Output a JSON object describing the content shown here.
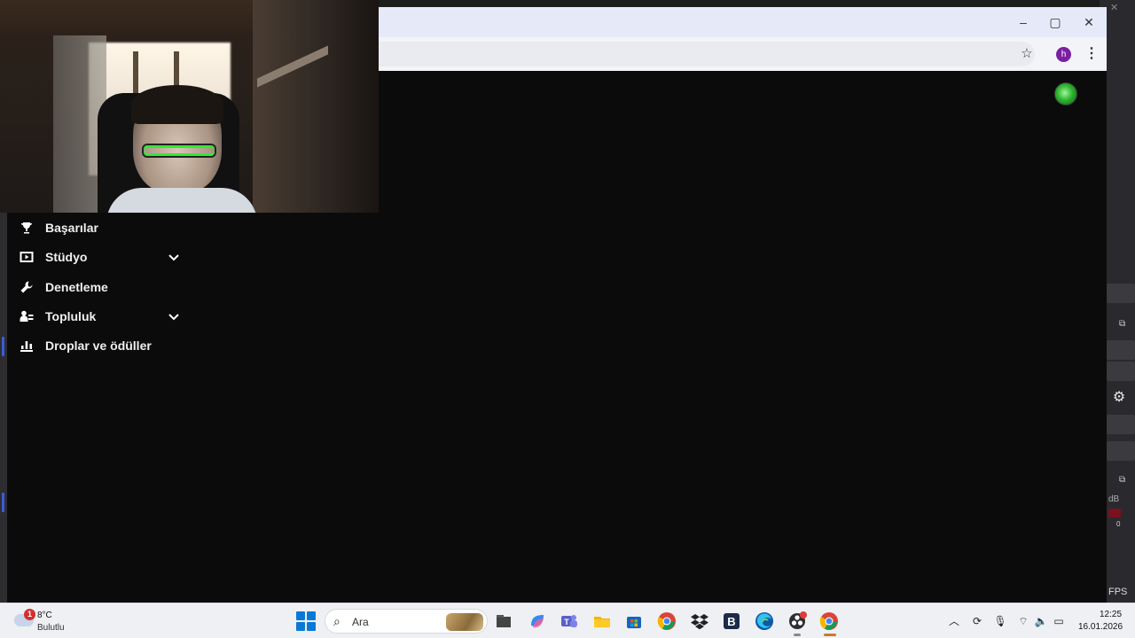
{
  "dashboard_menu": {
    "items": [
      {
        "label": "Başarılar",
        "icon": "trophy-icon",
        "expandable": false
      },
      {
        "label": "Stüdyo",
        "icon": "video-play-icon",
        "expandable": true
      },
      {
        "label": "Denetleme",
        "icon": "wrench-icon",
        "expandable": false
      },
      {
        "label": "Topluluk",
        "icon": "community-icon",
        "expandable": true
      },
      {
        "label": "Droplar ve ödüller",
        "icon": "drops-icon",
        "expandable": false
      }
    ]
  },
  "browser": {
    "profile_initial": "h",
    "window_buttons": {
      "minimize": "–",
      "maximize": "▢",
      "close": "✕"
    }
  },
  "background_app": {
    "db_label": "dB",
    "meter_zero": "0",
    "fps_label": "FPS"
  },
  "taskbar": {
    "weather": {
      "temp": "8°C",
      "desc": "Bulutlu",
      "badge": "1"
    },
    "search_placeholder": "Ara",
    "clock": {
      "time": "12:25",
      "date": "16.01.2026"
    },
    "apps": [
      "file-explorer-icon",
      "copilot-icon",
      "teams-icon",
      "folder-icon",
      "store-icon",
      "chrome-icon",
      "dropbox-icon",
      "b-app-icon",
      "edge-icon",
      "obs-icon",
      "chrome-active-icon"
    ]
  },
  "colors": {
    "page_bg": "#0b0b0b",
    "accent_purple": "#7b1fa2",
    "windows_blue": "#0a78d7"
  }
}
